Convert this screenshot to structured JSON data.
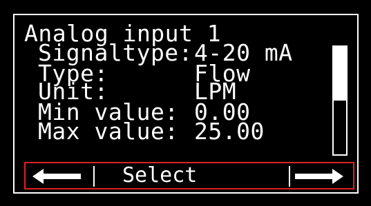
{
  "screen": {
    "title": "Analog input 1",
    "rows": [
      {
        "label": "Signaltype:",
        "value": "4-20 mA"
      },
      {
        "label": "Type:",
        "value": "Flow"
      },
      {
        "label": "Unit:",
        "value": "LPM"
      },
      {
        "label": "Min value:",
        "value": "0.00"
      },
      {
        "label": "Max value:",
        "value": "25.00"
      }
    ],
    "scroll_position": 0.5
  },
  "softkeys": {
    "left_icon": "arrow-left-icon",
    "center_label": "Select",
    "right_icon": "arrow-right-icon"
  },
  "colors": {
    "background": "#000000",
    "text": "#ffffff",
    "softkey_border": "#e02020"
  }
}
